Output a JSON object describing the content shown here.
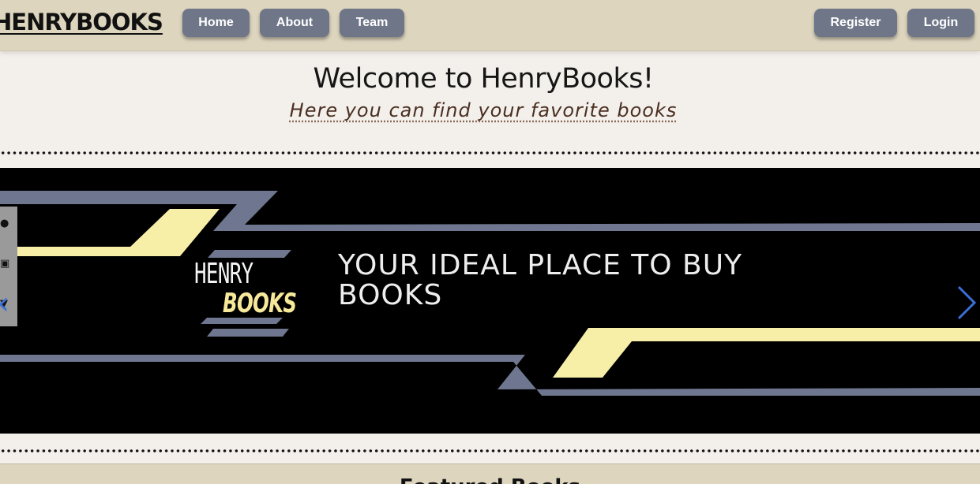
{
  "navbar": {
    "brand": "HENRYBOOKS",
    "links": {
      "home": "Home",
      "about": "About",
      "team": "Team"
    },
    "auth": {
      "register": "Register",
      "login": "Login"
    },
    "button_color": "#6f7688",
    "background": "#ddd5be"
  },
  "welcome": {
    "title": "Welcome to HenryBooks!",
    "subtitle": "Here you can find your favorite books"
  },
  "banner": {
    "logo_top": "HENRY",
    "logo_bottom": "BOOKS",
    "tagline_line1": "YOUR IDEAL PLACE TO BUY",
    "tagline_line2": "BOOKS",
    "accent_yellow": "#f7eea8",
    "accent_slate": "#6e778f",
    "social_icons": [
      "pinterest-icon",
      "instagram-icon",
      "facebook-icon"
    ],
    "prev_icon": "chevron-left-icon",
    "next_icon": "chevron-right-icon"
  },
  "featured": {
    "title": "Featured Books"
  }
}
